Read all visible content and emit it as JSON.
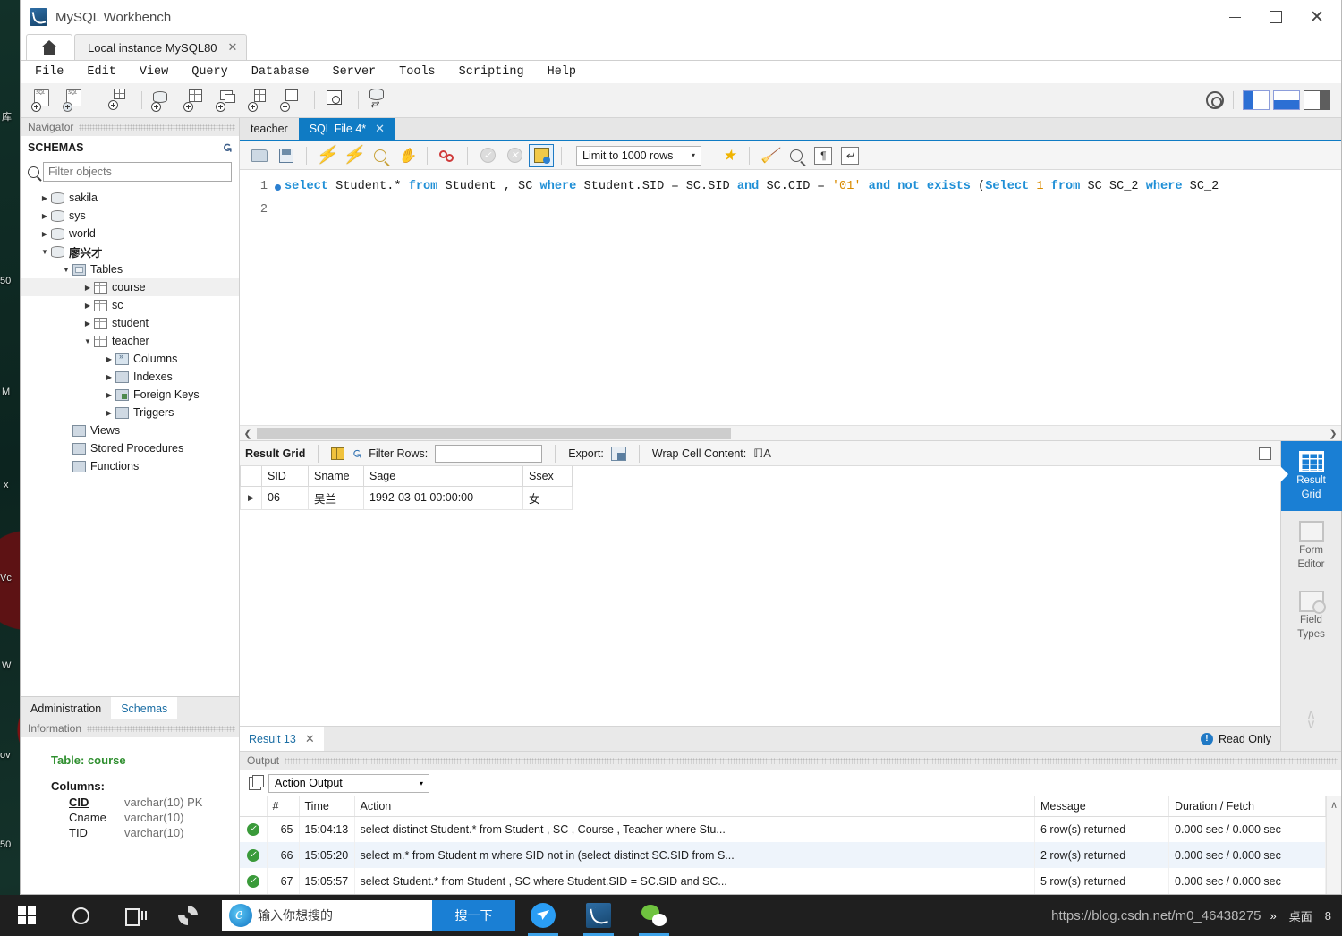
{
  "window": {
    "title": "MySQL Workbench",
    "minimize": "—",
    "maximize": "□",
    "close": "✕"
  },
  "tabs": {
    "home_icon": "home-icon",
    "connection": "Local instance MySQL80",
    "close_glyph": "✕"
  },
  "menu": [
    "File",
    "Edit",
    "View",
    "Query",
    "Database",
    "Server",
    "Tools",
    "Scripting",
    "Help"
  ],
  "main_toolbar": {
    "icons": [
      "new-sql-tab-icon",
      "open-sql-script-icon",
      "connection-info-icon",
      "new-schema-icon",
      "new-table-icon",
      "new-view-icon",
      "new-stored-procedure-icon",
      "new-function-icon",
      "search-data-icon",
      "reconnect-server-icon"
    ],
    "right": [
      "admin-gear-icon",
      "sidebar-toggle-icon",
      "output-toggle-icon",
      "secondary-sidebar-toggle-icon"
    ]
  },
  "navigator": {
    "header": "Navigator",
    "schemas_label": "SCHEMAS",
    "refresh_icon": "refresh-icon",
    "filter_placeholder": "Filter objects",
    "filter_value": "",
    "search_icon": "search-icon",
    "tree": [
      {
        "label": "sakila",
        "icon": "database-icon",
        "depth": 0,
        "arrow": "▶",
        "bold": false,
        "selected": false
      },
      {
        "label": "sys",
        "icon": "database-icon",
        "depth": 0,
        "arrow": "▶",
        "bold": false,
        "selected": false
      },
      {
        "label": "world",
        "icon": "database-icon",
        "depth": 0,
        "arrow": "▶",
        "bold": false,
        "selected": false
      },
      {
        "label": "廖兴才",
        "icon": "database-icon",
        "depth": 0,
        "arrow": "▼",
        "bold": true,
        "selected": false
      },
      {
        "label": "Tables",
        "icon": "tables-folder-icon",
        "depth": 1,
        "arrow": "▼",
        "bold": false,
        "selected": false
      },
      {
        "label": "course",
        "icon": "table-icon",
        "depth": 2,
        "arrow": "▶",
        "bold": false,
        "selected": true
      },
      {
        "label": "sc",
        "icon": "table-icon",
        "depth": 2,
        "arrow": "▶",
        "bold": false,
        "selected": false
      },
      {
        "label": "student",
        "icon": "table-icon",
        "depth": 2,
        "arrow": "▶",
        "bold": false,
        "selected": false
      },
      {
        "label": "teacher",
        "icon": "table-icon",
        "depth": 2,
        "arrow": "▼",
        "bold": false,
        "selected": false
      },
      {
        "label": "Columns",
        "icon": "columns-icon",
        "depth": 3,
        "arrow": "▶",
        "bold": false,
        "selected": false
      },
      {
        "label": "Indexes",
        "icon": "indexes-icon",
        "depth": 3,
        "arrow": "▶",
        "bold": false,
        "selected": false
      },
      {
        "label": "Foreign Keys",
        "icon": "foreign-keys-icon",
        "depth": 3,
        "arrow": "▶",
        "bold": false,
        "selected": false
      },
      {
        "label": "Triggers",
        "icon": "triggers-icon",
        "depth": 3,
        "arrow": "▶",
        "bold": false,
        "selected": false
      },
      {
        "label": "Views",
        "icon": "views-icon",
        "depth": 1,
        "arrow": "",
        "bold": false,
        "selected": false
      },
      {
        "label": "Stored Procedures",
        "icon": "stored-procedures-icon",
        "depth": 1,
        "arrow": "",
        "bold": false,
        "selected": false
      },
      {
        "label": "Functions",
        "icon": "functions-icon",
        "depth": 1,
        "arrow": "",
        "bold": false,
        "selected": false
      }
    ],
    "bottom_tabs": [
      {
        "label": "Administration",
        "active": false
      },
      {
        "label": "Schemas",
        "active": true
      }
    ]
  },
  "information": {
    "header": "Information",
    "table_label": "Table:",
    "table_name": "course",
    "columns_label": "Columns:",
    "columns": [
      {
        "name": "CID",
        "type": "varchar(10) PK",
        "pk": true
      },
      {
        "name": "Cname",
        "type": "varchar(10)",
        "pk": false
      },
      {
        "name": "TID",
        "type": "varchar(10)",
        "pk": false
      }
    ]
  },
  "editor": {
    "tabs": [
      {
        "label": "teacher",
        "active": false,
        "closable": false
      },
      {
        "label": "SQL File 4*",
        "active": true,
        "closable": true
      }
    ],
    "toolbar": {
      "icons": [
        "open-file-icon",
        "save-file-icon",
        "execute-icon",
        "execute-current-statement-icon",
        "explain-icon",
        "stop-icon",
        "toggle-breakpoint-icon",
        "commit-icon",
        "rollback-icon",
        "auto-commit-icon"
      ],
      "limit_label": "Limit to 1000 rows",
      "chevron": "▾",
      "right_icons": [
        "toggle-snippets-icon",
        "beautify-sql-icon",
        "find-icon",
        "toggle-invisible-chars-icon",
        "toggle-wrapping-icon"
      ]
    },
    "line_numbers": [
      "1",
      "2"
    ],
    "code_line_1": [
      {
        "t": "select ",
        "c": "kw"
      },
      {
        "t": "Student.* ",
        "c": "nm"
      },
      {
        "t": "from ",
        "c": "kw"
      },
      {
        "t": "Student , SC ",
        "c": "nm"
      },
      {
        "t": "where ",
        "c": "kw"
      },
      {
        "t": "Student.SID = SC.SID ",
        "c": "nm"
      },
      {
        "t": "and ",
        "c": "kw"
      },
      {
        "t": "SC.CID = ",
        "c": "nm"
      },
      {
        "t": "'01' ",
        "c": "str"
      },
      {
        "t": "and not exists ",
        "c": "kw"
      },
      {
        "t": "(",
        "c": "nm"
      },
      {
        "t": "Select ",
        "c": "kw"
      },
      {
        "t": "1 ",
        "c": "num"
      },
      {
        "t": "from ",
        "c": "kw"
      },
      {
        "t": "SC SC_2 ",
        "c": "nm"
      },
      {
        "t": "where ",
        "c": "kw"
      },
      {
        "t": "SC_2",
        "c": "nm"
      }
    ],
    "code_line_1_plain": "select Student.* from Student , SC where Student.SID = SC.SID and SC.CID = '01' and not exists (Select 1 from SC SC_2 where SC_2"
  },
  "results": {
    "toolbar": {
      "result_grid_label": "Result Grid",
      "grid_icon": "result-grid-icon",
      "refresh_icon": "refresh-rows-icon",
      "filter_label": "Filter Rows:",
      "filter_value": "",
      "export_label": "Export:",
      "export_icon": "export-recordset-icon",
      "wrap_label": "Wrap Cell Content:",
      "wrap_icon": "wrap-cell-icon",
      "panel_toggle_icon": "toggle-panel-icon"
    },
    "columns": [
      "SID",
      "Sname",
      "Sage",
      "Ssex"
    ],
    "rows": [
      {
        "marker": "▶",
        "SID": "06",
        "Sname": "吴兰",
        "Sage": "1992-03-01 00:00:00",
        "Ssex": "女"
      }
    ],
    "tab_label": "Result 13",
    "tab_close": "✕",
    "read_only": "Read Only",
    "info_icon": "info-icon"
  },
  "right_strip": {
    "buttons": [
      {
        "line1": "Result",
        "line2": "Grid",
        "icon": "result-grid-icon",
        "active": true
      },
      {
        "line1": "Form",
        "line2": "Editor",
        "icon": "form-editor-icon",
        "active": false
      },
      {
        "line1": "Field",
        "line2": "Types",
        "icon": "field-types-icon",
        "active": false
      }
    ],
    "scroll_up": "∧",
    "scroll_down": "∨"
  },
  "output": {
    "header": "Output",
    "copy_icon": "copy-icon",
    "selector_value": "Action Output",
    "selector_chevron": "▾",
    "columns": [
      "#",
      "Time",
      "Action",
      "Message",
      "Duration / Fetch"
    ],
    "rows": [
      {
        "status": "success",
        "idx": "65",
        "time": "15:04:13",
        "action": "select distinct Student.* from Student , SC , Course , Teacher  where Stu...",
        "message": "6 row(s) returned",
        "duration": "0.000 sec / 0.000 sec"
      },
      {
        "status": "success",
        "idx": "66",
        "time": "15:05:20",
        "action": "select m.* from Student m where SID not in (select distinct SC.SID from S...",
        "message": "2 row(s) returned",
        "duration": "0.000 sec / 0.000 sec"
      },
      {
        "status": "success",
        "idx": "67",
        "time": "15:05:57",
        "action": "select Student.* from Student , SC where Student.SID = SC.SID and SC...",
        "message": "5 row(s) returned",
        "duration": "0.000 sec / 0.000 sec"
      }
    ],
    "scroll_up": "∧"
  },
  "taskbar": {
    "start_icon": "windows-start-icon",
    "cortana_icon": "cortana-circle-icon",
    "task_view_icon": "task-view-icon",
    "fan_icon": "fan-app-icon",
    "search_placeholder": "输入你想搜的",
    "search_button": "搜一下",
    "ie_icon": "internet-explorer-icon",
    "apps": [
      "thunder-download-icon",
      "mysql-workbench-icon",
      "wechat-icon"
    ],
    "watermark": "https://blog.csdn.net/m0_46438275",
    "tray_overflow": "»",
    "desktop_label": "桌面",
    "tray_count": "8"
  },
  "desktop": {
    "icon_fragments": [
      "库",
      "50",
      "M",
      "x",
      "Vc",
      "W",
      "ov",
      "50"
    ]
  }
}
